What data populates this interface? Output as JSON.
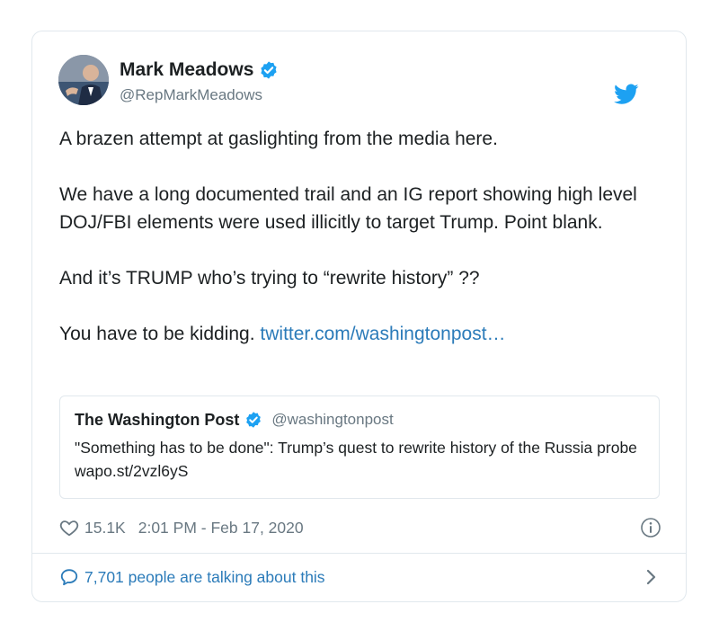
{
  "author": {
    "display_name": "Mark Meadows",
    "handle": "@RepMarkMeadows",
    "verified": true
  },
  "tweet": {
    "paragraphs": [
      "A brazen attempt at gaslighting from the media here.",
      "We have a long documented trail and an IG report showing high level DOJ/FBI elements were used illicitly to target Trump. Point blank.",
      "And it’s TRUMP who’s trying to “rewrite history” ??"
    ],
    "last_line_text": "You have to be kidding. ",
    "last_line_link": "twitter.com/washingtonpost…"
  },
  "quoted_tweet": {
    "display_name": "The Washington Post",
    "verified": true,
    "handle": "@washingtonpost",
    "text": "\"Something has to be done\": Trump’s quest to rewrite history of the Russia probe wapo.st/2vzl6yS"
  },
  "meta": {
    "likes": "15.1K",
    "timestamp": "2:01 PM - Feb 17, 2020"
  },
  "footer": {
    "conversation_text": "7,701 people are talking about this"
  },
  "icons": {
    "verified": "verified-badge-icon",
    "brand": "twitter-bird-icon",
    "like": "heart-icon",
    "info": "info-icon",
    "reply": "speech-bubble-icon",
    "chevron": "chevron-right-icon"
  },
  "colors": {
    "link": "#2b7bb9",
    "verified": "#1da1f2",
    "brand": "#1da1f2",
    "muted": "#697882",
    "border": "#e1e8ed"
  }
}
